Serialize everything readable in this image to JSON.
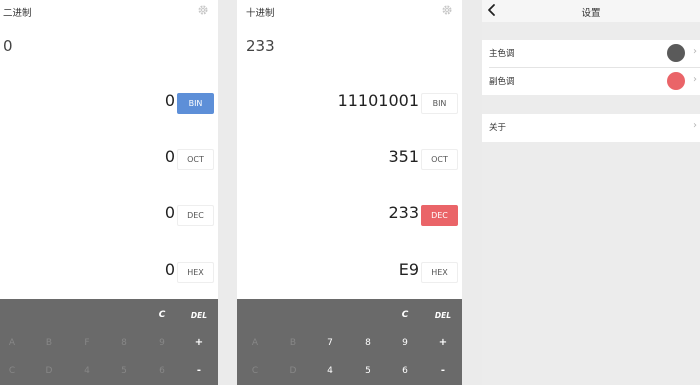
{
  "binary_panel": {
    "title": "二进制",
    "input": "0",
    "rows": [
      {
        "value": "0",
        "button": "BIN"
      },
      {
        "value": "0",
        "button": "OCT"
      },
      {
        "value": "0",
        "button": "DEC"
      },
      {
        "value": "0",
        "button": "HEX"
      }
    ],
    "keypad": {
      "row1": [
        "C",
        "DEL"
      ],
      "row2": [
        "A",
        "B",
        "F",
        "8",
        "9",
        "+"
      ],
      "row3": [
        "C",
        "D",
        "4",
        "5",
        "6",
        "-"
      ]
    }
  },
  "decimal_panel": {
    "title": "十进制",
    "input": "233",
    "rows": [
      {
        "value": "11101001",
        "button": "BIN"
      },
      {
        "value": "351",
        "button": "OCT"
      },
      {
        "value": "233",
        "button": "DEC"
      },
      {
        "value": "E9",
        "button": "HEX"
      }
    ],
    "keypad": {
      "row1": [
        "C",
        "DEL"
      ],
      "row2": [
        "A",
        "B",
        "7",
        "8",
        "9",
        "+"
      ],
      "row3": [
        "C",
        "D",
        "4",
        "5",
        "6",
        "-"
      ]
    }
  },
  "settings_panel": {
    "title": "设置",
    "items": [
      {
        "label": "主色调"
      },
      {
        "label": "副色调"
      },
      {
        "label": "关于"
      }
    ]
  },
  "icons": {
    "gear": "gear-icon",
    "back": "back-chevron-icon",
    "chevron": "chevron-right-icon"
  },
  "colors": {
    "primary": "#5d8fd8",
    "accent": "#ea6468",
    "primary_swatch": "#5a5a5a",
    "accent_swatch": "#ea6468",
    "keypad_bg": "#6a6a6a"
  }
}
